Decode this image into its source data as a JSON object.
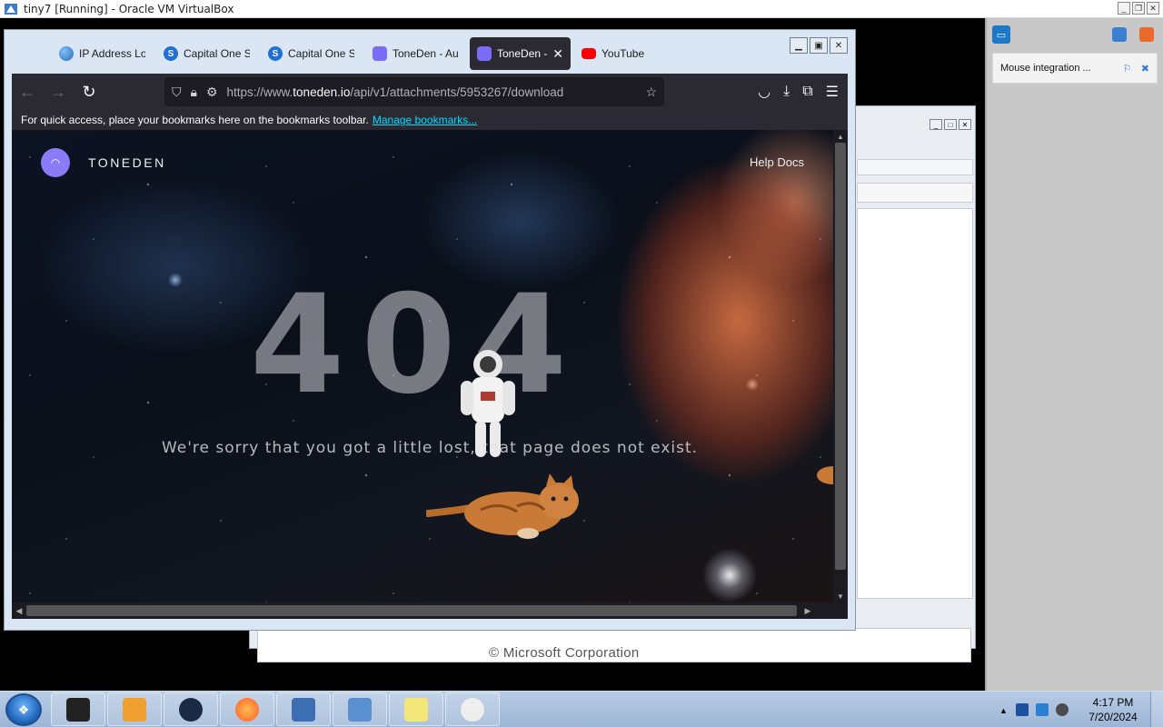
{
  "host": {
    "window_title": "tiny7 [Running] - Oracle VM VirtualBox",
    "notification": "Mouse integration ..."
  },
  "browser": {
    "tabs": [
      {
        "label": "IP Address Lo",
        "favicon": "globe-icon",
        "active": false
      },
      {
        "label": "Capital One S",
        "favicon": "capital-one-icon",
        "active": false
      },
      {
        "label": "Capital One S",
        "favicon": "capital-one-icon",
        "active": false
      },
      {
        "label": "ToneDen - Au",
        "favicon": "toneden-icon",
        "active": false
      },
      {
        "label": "ToneDen -",
        "favicon": "toneden-icon",
        "active": true
      },
      {
        "label": "YouTube",
        "favicon": "youtube-icon",
        "active": false
      }
    ],
    "url_prefix": "https://www.",
    "url_domain": "toneden.io",
    "url_path": "/api/v1/attachments/5953267/download",
    "bookmarks_message": "For quick access, place your bookmarks here on the bookmarks toolbar.",
    "bookmarks_link": "Manage bookmarks..."
  },
  "page": {
    "brand": "TONEDEN",
    "help_link": "Help Docs",
    "error_code": "404",
    "error_message": "We're sorry that you got a little lost, that page does not exist."
  },
  "guest_background": {
    "copyright": "© Microsoft Corporation"
  },
  "taskbar": {
    "time": "4:17 PM",
    "date": "7/20/2024",
    "apps": [
      "terminal",
      "media-player",
      "network",
      "firefox",
      "virtualbox",
      "tiny7",
      "sticky-notes",
      "alien"
    ]
  }
}
